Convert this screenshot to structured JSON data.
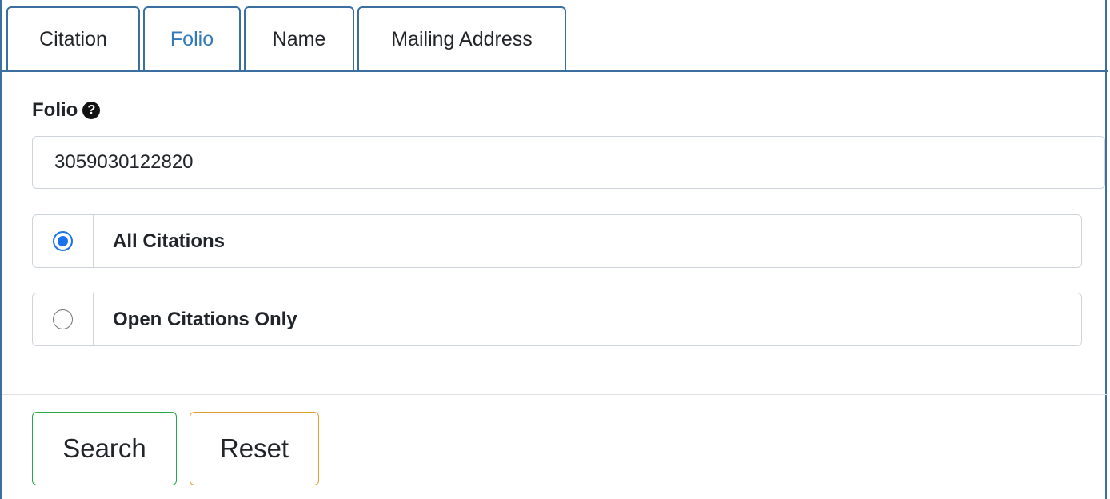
{
  "tabs": [
    {
      "label": "Citation",
      "active": false
    },
    {
      "label": "Folio",
      "active": true
    },
    {
      "label": "Name",
      "active": false
    },
    {
      "label": "Mailing Address",
      "active": false
    }
  ],
  "form": {
    "field_label": "Folio",
    "help_icon": "question-circle-icon",
    "folio_value": "3059030122820",
    "options": [
      {
        "label": "All Citations",
        "checked": true
      },
      {
        "label": "Open Citations Only",
        "checked": false
      }
    ]
  },
  "actions": {
    "search_label": "Search",
    "reset_label": "Reset"
  },
  "colors": {
    "tab_border": "#3a6fa0",
    "active_tab_text": "#337ab7",
    "radio_checked": "#1a73e8",
    "search_border": "#28a745",
    "reset_border": "#e0a030"
  }
}
